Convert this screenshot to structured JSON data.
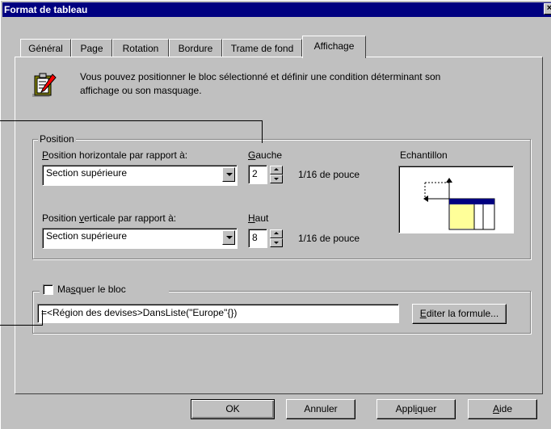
{
  "window": {
    "title": "Format de tableau",
    "close_glyph": "×"
  },
  "tabs": [
    {
      "label": "Général",
      "active": false
    },
    {
      "label": "Page",
      "active": false
    },
    {
      "label": "Rotation",
      "active": false
    },
    {
      "label": "Bordure",
      "active": false
    },
    {
      "label": "Trame de fond",
      "active": false
    },
    {
      "label": "Affichage",
      "active": true
    }
  ],
  "intro": {
    "icon": "clipboard-pencil-icon",
    "line1": "Vous pouvez positionner le bloc sélectionné et définir une condition déterminant son",
    "line2": "affichage ou son masquage."
  },
  "position_group": {
    "label": "Position",
    "horizontal_label_mnemonic": "P",
    "horizontal_label_rest": "osition horizontale par rapport à:",
    "horizontal_value": "Section supérieure",
    "gauche_mnemonic": "G",
    "gauche_rest": "auche",
    "gauche_value": "2",
    "vertical_label_pre": "Position ",
    "vertical_label_mnemonic": "v",
    "vertical_label_rest": "erticale par rapport à:",
    "vertical_value": "Section supérieure",
    "haut_mnemonic": "H",
    "haut_rest": "aut",
    "haut_value": "8",
    "unit": "1/16 de pouce",
    "sample_label": "Echantillon"
  },
  "hide_group": {
    "checkbox_pre": "Ma",
    "checkbox_mnemonic": "s",
    "checkbox_rest": "quer le bloc",
    "checked": false,
    "formula": "=<Région des devises>DansListe(\"Europe\"{})",
    "edit_formula_mnemonic": "E",
    "edit_formula_rest": "diter la formule..."
  },
  "buttons": {
    "ok": "OK",
    "cancel": "Annuler",
    "apply_pre": "Appl",
    "apply_mnemonic": "i",
    "apply_rest": "quer",
    "help_mnemonic": "A",
    "help_rest": "ide"
  },
  "colors": {
    "title_bar": "#000080",
    "face": "#c0c0c0",
    "sample_fill": "#ffff99",
    "sample_header": "#000080"
  }
}
